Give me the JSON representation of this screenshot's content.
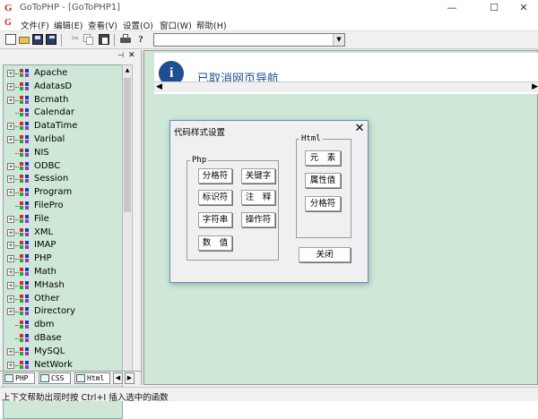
{
  "window": {
    "icon_glyph": "G",
    "title": "GoToPHP - [GoToPHP1]",
    "controls": {
      "minimize": "—",
      "maximize": "☐",
      "close": "✕"
    }
  },
  "menu": [
    "文件(F)",
    "编辑(E)",
    "查看(V)",
    "设置(O)",
    "窗口(W)",
    "帮助(H)"
  ],
  "toolbar": {
    "icons": [
      "new-file-icon",
      "open-folder-icon",
      "save-icon",
      "save-all-icon",
      "cut-icon",
      "copy-icon",
      "paste-icon",
      "print-icon",
      "help-icon"
    ],
    "combo_value": "",
    "combo_arrow": "▼"
  },
  "left_pane": {
    "strip_btn_pin": "⊣",
    "strip_btn_close": "✕",
    "tree_items": [
      "Apache",
      "AdatasD",
      "Bcmath",
      "Calendar",
      "DataTime",
      "Varibal",
      "NIS",
      "ODBC",
      "Session",
      "Program",
      "FilePro",
      "File",
      "XML",
      "IMAP",
      "PHP",
      "Math",
      "MHash",
      "Other",
      "Directory",
      "dbm",
      "dBase",
      "MySQL",
      "NetWork"
    ],
    "tabs": [
      "PHP",
      "CSS",
      "Html"
    ],
    "tab_nav": [
      "◀",
      "▶"
    ]
  },
  "browser": {
    "icon_glyph": "i",
    "message": "已取消网页导航",
    "scroll_left": "◀",
    "scroll_right": "▶"
  },
  "dialog": {
    "title": "代码样式设置",
    "close": "✕",
    "php_group": "Php",
    "php_buttons": [
      "分格符",
      "关键字",
      "标识符",
      "注　释",
      "字符串",
      "操作符",
      "数　值"
    ],
    "html_group": "Html",
    "html_buttons": [
      "元　素",
      "属性值",
      "分格符"
    ],
    "close_button": "关闭"
  },
  "status_bar": {
    "text": "上下文帮助出现时按 Ctrl+I 插入选中的函数"
  },
  "colors": {
    "pane_bg": "#cfe7d6",
    "dialog_border": "#5b8fd6",
    "nav_blue": "#1d4f91"
  }
}
